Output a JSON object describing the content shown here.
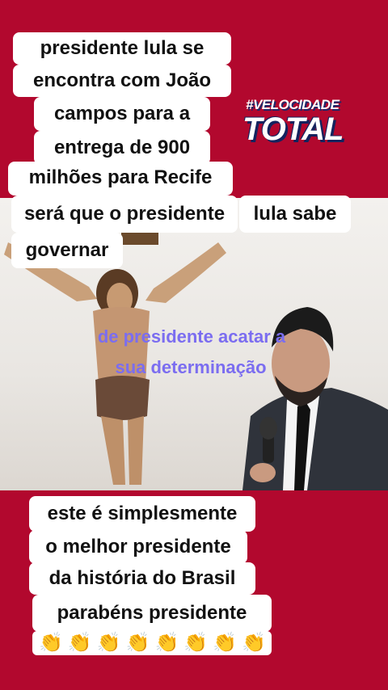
{
  "top_caption": {
    "lines": [
      "presidente lula se",
      "encontra com João",
      "campos para a",
      "entrega de 900",
      "milhões para Recife",
      "será que o presidente",
      "lula sabe",
      "governar"
    ]
  },
  "logo": {
    "tag": "#VELOCIDADE",
    "name": "TOTAL"
  },
  "video_overlay": {
    "line1": "de presidente acatar a",
    "line2": "sua determinação"
  },
  "bottom_caption": {
    "lines": [
      "este é simplesmente",
      "o melhor presidente",
      "da história do Brasil",
      "parabéns presidente"
    ],
    "emoji": "👏👏👏👏👏👏👏👏"
  },
  "colors": {
    "background": "#b2082e",
    "overlay_text": "#7b6df0",
    "logo_outline": "#14235e"
  }
}
